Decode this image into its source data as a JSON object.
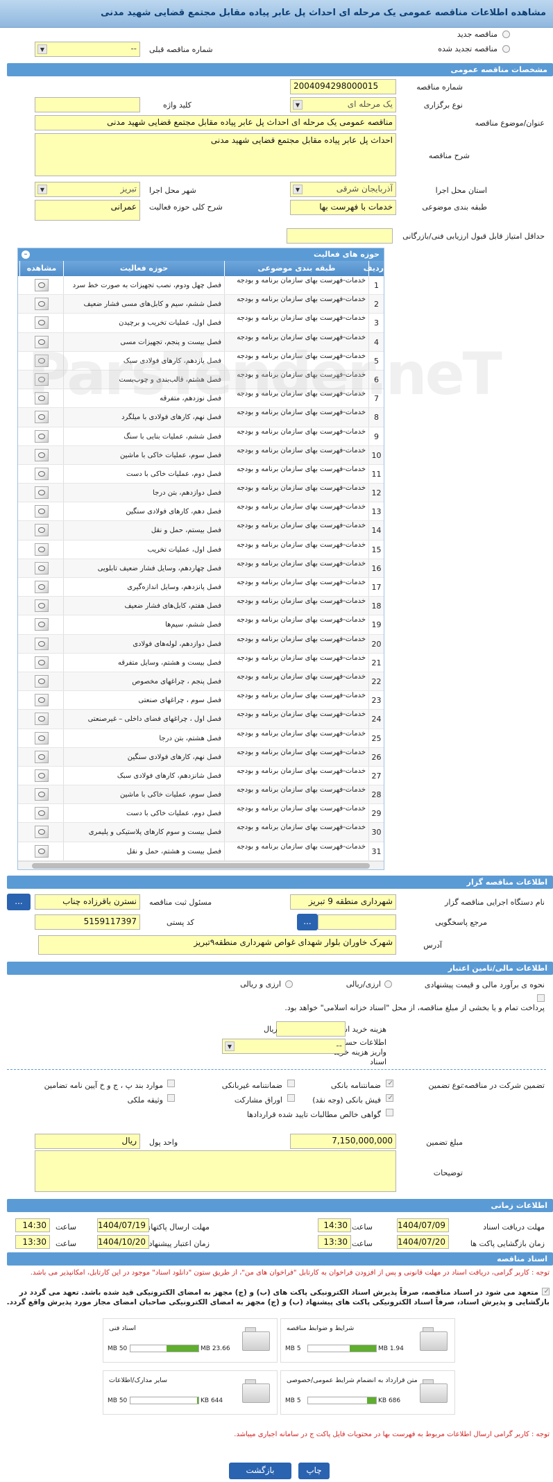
{
  "title": "مشاهده اطلاعات مناقصه عمومی یک مرحله ای احداث پل عابر پیاده مقابل مجتمع قضایی شهید مدنی",
  "top": {
    "new_tender": "مناقصه جدید",
    "renewed_tender": "مناقصه تجدید شده",
    "prev_number_label": "شماره مناقصه قبلی",
    "prev_number_value": "--"
  },
  "general": {
    "header": "مشخصات مناقصه عمومی",
    "number_label": "شماره مناقصه",
    "number_value": "2004094298000015",
    "type_label": "نوع برگزاری",
    "type_value": "یک مرحله ای",
    "keyword_label": "کلید واژه",
    "keyword_value": "",
    "subject_label": "عنوان/موضوع مناقصه",
    "subject_value": "مناقصه عمومی یک مرحله ای احداث پل عابر پیاده مقابل مجتمع قضایی شهید مدنی",
    "desc_label": "شرح مناقصه",
    "desc_value": "احداث پل عابر پیاده مقابل مجتمع قضایی شهید مدنی",
    "province_label": "استان محل اجرا",
    "province_value": "آذربایجان شرقی",
    "city_label": "شهر محل اجرا",
    "city_value": "تبریز",
    "category_label": "طبقه بندی موضوعی",
    "category_value": "خدمات با فهرست بها",
    "activity_label": "شرح کلی حوزه فعالیت",
    "activity_value": "عمرانی",
    "min_score_label": "حداقل امتیاز قابل قبول ارزیابی فنی/بازرگانی",
    "min_score_value": ""
  },
  "activities": {
    "header": "حوزه های فعالیت",
    "columns": [
      "ردیف",
      "طبقه بندی موضوعی",
      "حوزه فعالیت",
      "مشاهده"
    ],
    "rows": [
      {
        "n": "1",
        "t": "خدمات-فهرست بهای سازمان برنامه و بودجه",
        "a": "فصل چهل ودوم، نصب تجهیزات به صورت خط سرد"
      },
      {
        "n": "2",
        "t": "خدمات-فهرست بهای سازمان برنامه و بودجه",
        "a": "فصل ششم، سیم و کابل‌های مسی فشار ضعیف"
      },
      {
        "n": "3",
        "t": "خدمات-فهرست بهای سازمان برنامه و بودجه",
        "a": "فصل اول، عملیات تخریب و برچیدن"
      },
      {
        "n": "4",
        "t": "خدمات-فهرست بهای سازمان برنامه و بودجه",
        "a": "فصل بیست و پنجم، تجهیزات مسی"
      },
      {
        "n": "5",
        "t": "خدمات-فهرست بهای سازمان برنامه و بودجه",
        "a": "فصل یازدهم، کارهای فولادی سبک"
      },
      {
        "n": "6",
        "t": "خدمات-فهرست بهای سازمان برنامه و بودجه",
        "a": "فصل هشتم، قالب‌بندی و چوب‌بست"
      },
      {
        "n": "7",
        "t": "خدمات-فهرست بهای سازمان برنامه و بودجه",
        "a": "فصل نوزدهم، متفرقه"
      },
      {
        "n": "8",
        "t": "خدمات-فهرست بهای سازمان برنامه و بودجه",
        "a": "فصل نهم، کارهای فولادی با میلگرد"
      },
      {
        "n": "9",
        "t": "خدمات-فهرست بهای سازمان برنامه و بودجه",
        "a": "فصل ششم، عملیات بنایی با سنگ"
      },
      {
        "n": "10",
        "t": "خدمات-فهرست بهای سازمان برنامه و بودجه",
        "a": "فصل سوم، عملیات خاکی با ماشین"
      },
      {
        "n": "11",
        "t": "خدمات-فهرست بهای سازمان برنامه و بودجه",
        "a": "فصل دوم، عملیات خاکی با دست"
      },
      {
        "n": "12",
        "t": "خدمات-فهرست بهای سازمان برنامه و بودجه",
        "a": "فصل دوازدهم، بتن درجا"
      },
      {
        "n": "13",
        "t": "خدمات-فهرست بهای سازمان برنامه و بودجه",
        "a": "فصل دهم، کارهای فولادی سنگین"
      },
      {
        "n": "14",
        "t": "خدمات-فهرست بهای سازمان برنامه و بودجه",
        "a": "فصل بیستم، حمل و نقل"
      },
      {
        "n": "15",
        "t": "خدمات-فهرست بهای سازمان برنامه و بودجه",
        "a": "فصل اول، عملیات تخریب"
      },
      {
        "n": "16",
        "t": "خدمات-فهرست بهای سازمان برنامه و بودجه",
        "a": "فصل چهاردهم، وسایل فشار ضعیف تابلویی"
      },
      {
        "n": "17",
        "t": "خدمات-فهرست بهای سازمان برنامه و بودجه",
        "a": "فصل پانزدهم، وسایل اندازه‌گیری"
      },
      {
        "n": "18",
        "t": "خدمات-فهرست بهای سازمان برنامه و بودجه",
        "a": "فصل هفتم، کابل‌های فشار ضعیف"
      },
      {
        "n": "19",
        "t": "خدمات-فهرست بهای سازمان برنامه و بودجه",
        "a": "فصل ششم، سیم‌ها"
      },
      {
        "n": "20",
        "t": "خدمات-فهرست بهای سازمان برنامه و بودجه",
        "a": "فصل دوازدهم، لوله‌های فولادی"
      },
      {
        "n": "21",
        "t": "خدمات-فهرست بهای سازمان برنامه و بودجه",
        "a": "فصل بیست و هشتم، وسایل متفرقه"
      },
      {
        "n": "22",
        "t": "خدمات-فهرست بهای سازمان برنامه و بودجه",
        "a": "فصل پنجم ، چراغهای مخصوص"
      },
      {
        "n": "23",
        "t": "خدمات-فهرست بهای سازمان برنامه و بودجه",
        "a": "فصل سوم ، چراغهای صنعتی"
      },
      {
        "n": "24",
        "t": "خدمات-فهرست بهای سازمان برنامه و بودجه",
        "a": "فصل اول ، چراغهای فضای داخلی – غیرصنعتی"
      },
      {
        "n": "25",
        "t": "خدمات-فهرست بهای سازمان برنامه و بودجه",
        "a": "فصل هشتم، بتن درجا"
      },
      {
        "n": "26",
        "t": "خدمات-فهرست بهای سازمان برنامه و بودجه",
        "a": "فصل نهم، کارهای فولادی سنگین"
      },
      {
        "n": "27",
        "t": "خدمات-فهرست بهای سازمان برنامه و بودجه",
        "a": "فصل شانزدهم، کارهای فولادی سبک"
      },
      {
        "n": "28",
        "t": "خدمات-فهرست بهای سازمان برنامه و بودجه",
        "a": "فصل سوم، عملیات خاکی با ماشین"
      },
      {
        "n": "29",
        "t": "خدمات-فهرست بهای سازمان برنامه و بودجه",
        "a": "فصل دوم، عملیات خاکی با دست"
      },
      {
        "n": "30",
        "t": "خدمات-فهرست بهای سازمان برنامه و بودجه",
        "a": "فصل بیست و سوم کارهای پلاستیکی و پلیمری"
      },
      {
        "n": "31",
        "t": "خدمات-فهرست بهای سازمان برنامه و بودجه",
        "a": "فصل بیست و هشتم، حمل و نقل"
      }
    ]
  },
  "organizer": {
    "header": "اطلاعات مناقصه گزار",
    "org_label": "نام دستگاه اجرایی مناقصه گزار",
    "org_value": "شهرداری منطقه 9 تبریز",
    "resp_label": "مسئول ثبت مناقصه",
    "resp_value": "نسترن باقرزاده چناب",
    "ref_label": "مرجع پاسخگویی",
    "ref_value": "",
    "postal_label": "کد پستی",
    "postal_value": "5159117397",
    "addr_label": "آدرس",
    "addr_value": "شهرک خاوران بلوار شهدای غواص شهرداری منطقه۹تبریز",
    "dots": "..."
  },
  "finance": {
    "header": "اطلاعات مالی/تامین اعتبار",
    "estimate_label": "نحوه ی برآورد مالی و قیمت پیشنهادی",
    "opt_rial": "ارزی/ریالی",
    "opt_fx": "ارزی و ریالی",
    "payment_note": "پرداخت تمام و یا بخشی از مبلغ مناقصه، از محل \"اسناد خزانه اسلامی\" خواهد بود.",
    "doc_cost_label": "هزینه خرید اسناد",
    "doc_cost_unit": "ریال",
    "account_label": "اطلاعات حساب جهت واریز هزینه خرید اسناد",
    "account_value": "--"
  },
  "guarantee": {
    "label": "تضمین شرکت در مناقصه:",
    "type_label": "نوع تضمین",
    "options": [
      "ضمانتنامه بانکی",
      "ضمانتنامه غیربانکی",
      "موارد بند پ ، ج و خ آیین نامه تضامین",
      "فیش بانکی (وجه نقد)",
      "اوراق مشارکت",
      "وثیقه ملکی",
      "گواهی خالص مطالبات تایید شده قراردادها"
    ],
    "amount_label": "مبلغ تضمین",
    "amount_value": "7,150,000,000",
    "unit_label": "واحد پول",
    "unit_value": "ریال",
    "desc_label": "توضیحات"
  },
  "timing": {
    "header": "اطلاعات زمانی",
    "receive_label": "مهلت دریافت اسناد",
    "receive_date": "1404/07/09",
    "receive_time": "14:30",
    "submit_label": "مهلت ارسال پاکتهای پیشنهاد",
    "submit_date": "1404/07/19",
    "submit_time": "14:30",
    "open_label": "زمان بازگشایی پاکت ها",
    "open_date": "1404/07/20",
    "open_time": "13:30",
    "valid_label": "زمان اعتبار پیشنهاد",
    "valid_date": "1404/10/20",
    "valid_time": "13:30",
    "hour_label": "ساعت"
  },
  "docs": {
    "header": "اسناد مناقصه",
    "note1": "توجه : کاربر گرامی، دریافت اسناد در مهلت قانونی و پس از افزودن فراخوان به کارتابل \"فراخوان های من\"، از طریق ستون \"دانلود اسناد\" موجود در این کارتابل، امکانپذیر می باشد.",
    "commit": "متعهد می شود در اسناد مناقصه، صرفاً پذیرش اسناد الکترونیکی پاکت های (ب) و (ج) مجهز به امضای الکترونیکی قید شده باشد. تعهد می گردد در بازگشایی و پذیرش اسناد، صرفاً اسناد الکترونیکی پاکت های پیشنهاد (ب) و (ج) مجهز به امضای الکترونیکی صاحبان امضای مجاز مورد پذیرش واقع گردد.",
    "items": [
      {
        "name": "شرایط و ضوابط مناقصه",
        "size": "1.94 MB",
        "max": "5 MB",
        "fill": 0.39
      },
      {
        "name": "اسناد فنی",
        "size": "23.66 MB",
        "max": "50 MB",
        "fill": 0.47
      },
      {
        "name": "متن قرارداد به انضمام شرایط عمومی/خصوصی",
        "size": "686 KB",
        "max": "5 MB",
        "fill": 0.13
      },
      {
        "name": "سایر مدارک/اطلاعات",
        "size": "644 KB",
        "max": "50 MB",
        "fill": 0.02
      }
    ],
    "note2": "توجه : کاربر گرامی ارسال اطلاعات مربوط به فهرست بها در محتویات فایل پاکت ج در سامانه اجباری میباشد."
  },
  "buttons": {
    "back": "بازگشت",
    "print": "چاپ"
  },
  "watermark": "ParsTender.neT"
}
